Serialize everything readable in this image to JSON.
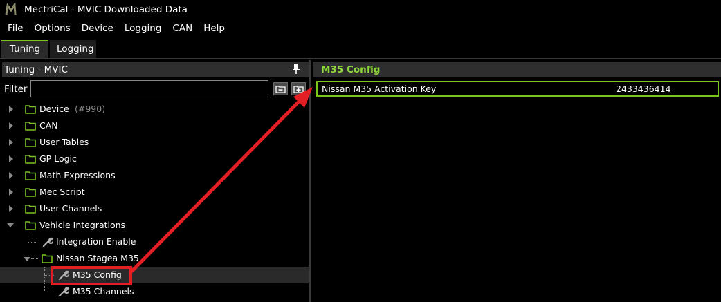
{
  "window": {
    "title": "MectriCal - MVIC Downloaded Data"
  },
  "menu": {
    "items": [
      "File",
      "Options",
      "Device",
      "Logging",
      "CAN",
      "Help"
    ]
  },
  "tabs": [
    {
      "label": "Tuning"
    },
    {
      "label": "Logging"
    }
  ],
  "left_panel": {
    "title": "Tuning - MVIC",
    "filter_label": "Filter",
    "filter_value": "",
    "tree": [
      {
        "label": "Device",
        "suffix": "(#990)"
      },
      {
        "label": "CAN"
      },
      {
        "label": "User Tables"
      },
      {
        "label": "GP Logic"
      },
      {
        "label": "Math Expressions"
      },
      {
        "label": "Mec Script"
      },
      {
        "label": "User Channels"
      },
      {
        "label": "Vehicle Integrations"
      },
      {
        "label": "Integration Enable"
      },
      {
        "label": "Nissan Stagea M35"
      },
      {
        "label": "M35 Config"
      },
      {
        "label": "M35 Channels"
      }
    ]
  },
  "right_panel": {
    "title": "M35 Config",
    "params": [
      {
        "name": "Nissan M35 Activation Key",
        "value": "2433436414"
      }
    ]
  },
  "colors": {
    "accent": "#7bc41f",
    "header_text": "#8fd63a",
    "annotation": "#e31e24"
  }
}
